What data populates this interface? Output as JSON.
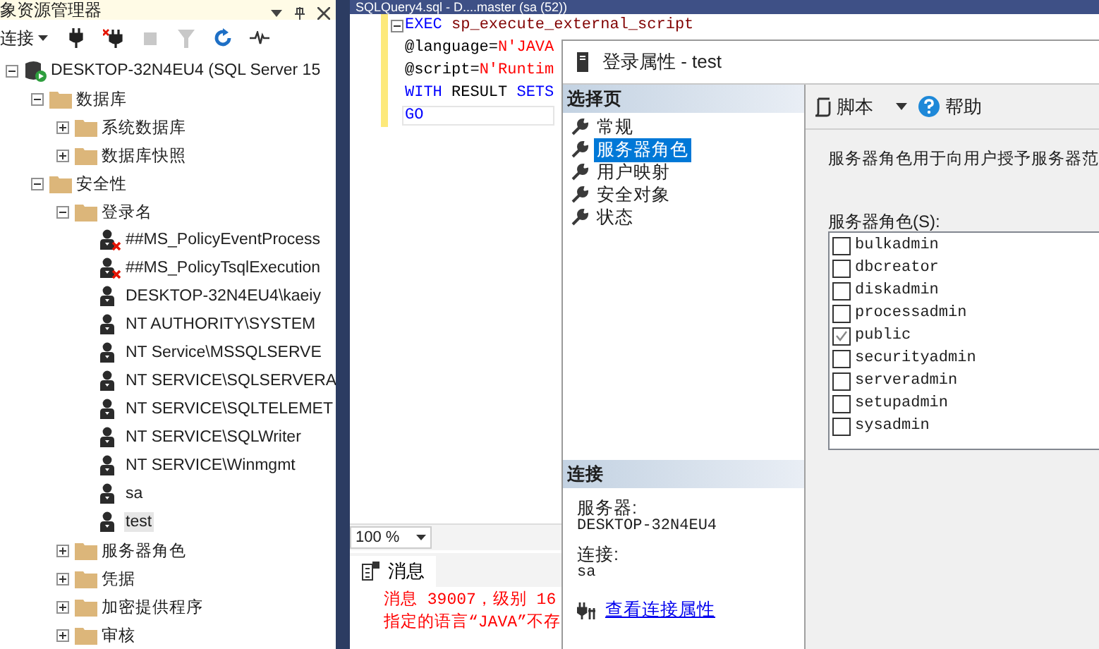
{
  "explorer": {
    "title": "象资源管理器",
    "connect_label": "连接",
    "tree": [
      {
        "label": "DESKTOP-32N4EU4 (SQL Server 15",
        "kind": "server",
        "expanded": true,
        "selected": false,
        "children": [
          {
            "label": "数据库",
            "kind": "folder",
            "expanded": true,
            "selected": false,
            "children": [
              {
                "label": "系统数据库",
                "kind": "folder",
                "expanded": false,
                "selected": false
              },
              {
                "label": "数据库快照",
                "kind": "folder",
                "expanded": false,
                "selected": false
              }
            ]
          },
          {
            "label": "安全性",
            "kind": "folder",
            "expanded": true,
            "selected": false,
            "children": [
              {
                "label": "登录名",
                "kind": "folder",
                "expanded": true,
                "selected": false,
                "children": [
                  {
                    "label": "##MS_PolicyEventProcess",
                    "kind": "login",
                    "disabled": true,
                    "selected": false
                  },
                  {
                    "label": "##MS_PolicyTsqlExecution",
                    "kind": "login",
                    "disabled": true,
                    "selected": false
                  },
                  {
                    "label": "DESKTOP-32N4EU4\\kaeiy",
                    "kind": "login",
                    "disabled": false,
                    "selected": false
                  },
                  {
                    "label": "NT AUTHORITY\\SYSTEM",
                    "kind": "login",
                    "disabled": false,
                    "selected": false
                  },
                  {
                    "label": "NT Service\\MSSQLSERVE",
                    "kind": "login",
                    "disabled": false,
                    "selected": false
                  },
                  {
                    "label": "NT SERVICE\\SQLSERVERA",
                    "kind": "login",
                    "disabled": false,
                    "selected": false
                  },
                  {
                    "label": "NT SERVICE\\SQLTELEMET",
                    "kind": "login",
                    "disabled": false,
                    "selected": false
                  },
                  {
                    "label": "NT SERVICE\\SQLWriter",
                    "kind": "login",
                    "disabled": false,
                    "selected": false
                  },
                  {
                    "label": "NT SERVICE\\Winmgmt",
                    "kind": "login",
                    "disabled": false,
                    "selected": false
                  },
                  {
                    "label": "sa",
                    "kind": "login",
                    "disabled": false,
                    "selected": false
                  },
                  {
                    "label": "test",
                    "kind": "login",
                    "disabled": false,
                    "selected": true
                  }
                ]
              },
              {
                "label": "服务器角色",
                "kind": "folder",
                "expanded": false,
                "selected": false
              },
              {
                "label": "凭据",
                "kind": "folder",
                "expanded": false,
                "selected": false
              },
              {
                "label": "加密提供程序",
                "kind": "folder",
                "expanded": false,
                "selected": false
              },
              {
                "label": "审核",
                "kind": "folder",
                "expanded": false,
                "selected": false
              }
            ]
          }
        ]
      }
    ]
  },
  "editor": {
    "tab_title": "SQLQuery4.sql - D....master (sa (52))",
    "lines": [
      {
        "tokens": [
          {
            "kind": "keyword",
            "text": "EXEC "
          },
          {
            "kind": "proc",
            "text": "sp_execute_external_script"
          }
        ]
      },
      {
        "tokens": [
          {
            "kind": "plain",
            "text": "@language="
          },
          {
            "kind": "string",
            "text": "N'JAVA"
          }
        ]
      },
      {
        "tokens": [
          {
            "kind": "plain",
            "text": "@script="
          },
          {
            "kind": "string",
            "text": "N'Runtim"
          }
        ]
      },
      {
        "tokens": [
          {
            "kind": "keyword",
            "text": "WITH "
          },
          {
            "kind": "plain",
            "text": "RESULT "
          },
          {
            "kind": "keyword",
            "text": "SETS"
          }
        ]
      },
      {
        "tokens": [
          {
            "kind": "keyword",
            "text": "GO"
          }
        ]
      }
    ],
    "zoom": "100 %"
  },
  "results": {
    "tab": "消息",
    "messages": [
      "消息 39007，级别 16",
      "指定的语言“JAVA”不存"
    ]
  },
  "dialog": {
    "title": "登录属性 - test",
    "pages_header": "选择页",
    "pages": [
      {
        "label": "常规",
        "selected": false
      },
      {
        "label": "服务器角色",
        "selected": true
      },
      {
        "label": "用户映射",
        "selected": false
      },
      {
        "label": "安全对象",
        "selected": false
      },
      {
        "label": "状态",
        "selected": false
      }
    ],
    "connection": {
      "header": "连接",
      "server_label": "服务器:",
      "server": "DESKTOP-32N4EU4",
      "login_label": "连接:",
      "login": "sa",
      "link": "查看连接属性"
    },
    "toolbar": {
      "script": "脚本",
      "help": "帮助"
    },
    "description": "服务器角色用于向用户授予服务器范",
    "roles_label": "服务器角色(S):",
    "roles": [
      {
        "name": "bulkadmin",
        "checked": false
      },
      {
        "name": "dbcreator",
        "checked": false
      },
      {
        "name": "diskadmin",
        "checked": false
      },
      {
        "name": "processadmin",
        "checked": false
      },
      {
        "name": "public",
        "checked": true
      },
      {
        "name": "securityadmin",
        "checked": false
      },
      {
        "name": "serveradmin",
        "checked": false
      },
      {
        "name": "setupadmin",
        "checked": false
      },
      {
        "name": "sysadmin",
        "checked": false
      }
    ]
  }
}
